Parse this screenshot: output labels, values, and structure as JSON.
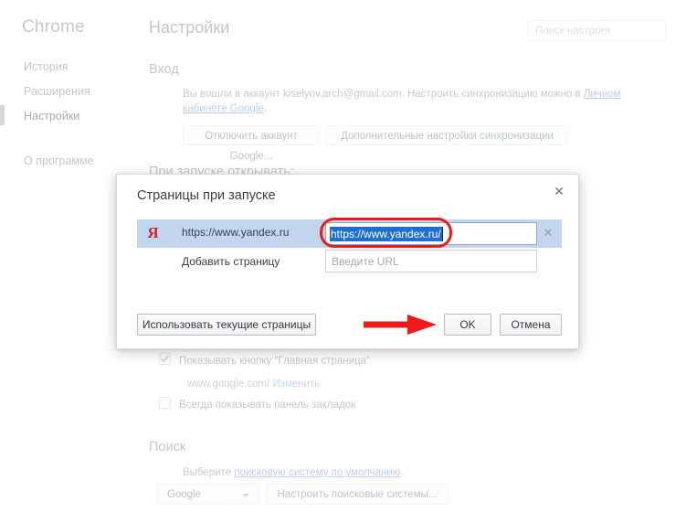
{
  "app": {
    "brand": "Chrome",
    "page_title": "Настройки"
  },
  "search": {
    "placeholder": "Поиск настроек"
  },
  "sidebar": {
    "items": [
      {
        "label": "История",
        "active": false
      },
      {
        "label": "Расширения",
        "active": false
      },
      {
        "label": "Настройки",
        "active": true
      },
      {
        "label": "О программе",
        "active": false
      }
    ]
  },
  "settings": {
    "signin": {
      "heading": "Вход",
      "description_before": "Вы вошли в аккаунт kiselyov.arch@gmail.com. Настроить синхронизацию можно в ",
      "description_link": "Личном кабинете Google",
      "description_after": ".",
      "disconnect_button": "Отключить аккаунт Google...",
      "advanced_sync_button": "Дополнительные настройки синхронизации"
    },
    "startup": {
      "heading": "При запуске открывать:"
    },
    "appearance": {
      "show_home_button": "Показывать кнопку \"Главная страница\"",
      "home_url": "www.google.com/",
      "home_change_link": "Изменить",
      "always_show_bookmarks": "Всегда показывать панель закладок"
    },
    "search_section": {
      "heading": "Поиск",
      "description_before": "Выберите ",
      "description_link": "поисковую систему по умолчанию",
      "description_after": ".",
      "engine_selected": "Google",
      "manage_button": "Настроить поисковые системы..."
    }
  },
  "dialog": {
    "title": "Страницы при запуске",
    "close_label": "✕",
    "rows": [
      {
        "favicon": "yandex-icon",
        "favicon_glyph": "Я",
        "label": "https://www.yandex.ru",
        "input_value": "https://www.yandex.ru/",
        "input_selected": true,
        "remove_label": "✕"
      }
    ],
    "add_row": {
      "label": "Добавить страницу",
      "placeholder": "Введите URL",
      "value": ""
    },
    "buttons": {
      "use_current": "Использовать текущие страницы",
      "ok": "OK",
      "cancel": "Отмена"
    }
  },
  "annotations": {
    "highlight_rect_color": "#ef1b1b",
    "arrow_color": "#ef1b1b",
    "arrow_points_to": "ok-button"
  },
  "colors": {
    "selection_blue": "#1f6fd0",
    "row_highlight": "#c2d7ef",
    "link_blue": "#2b6ec4",
    "yandex_red": "#e02020",
    "annotation_red": "#ef1b1b"
  }
}
